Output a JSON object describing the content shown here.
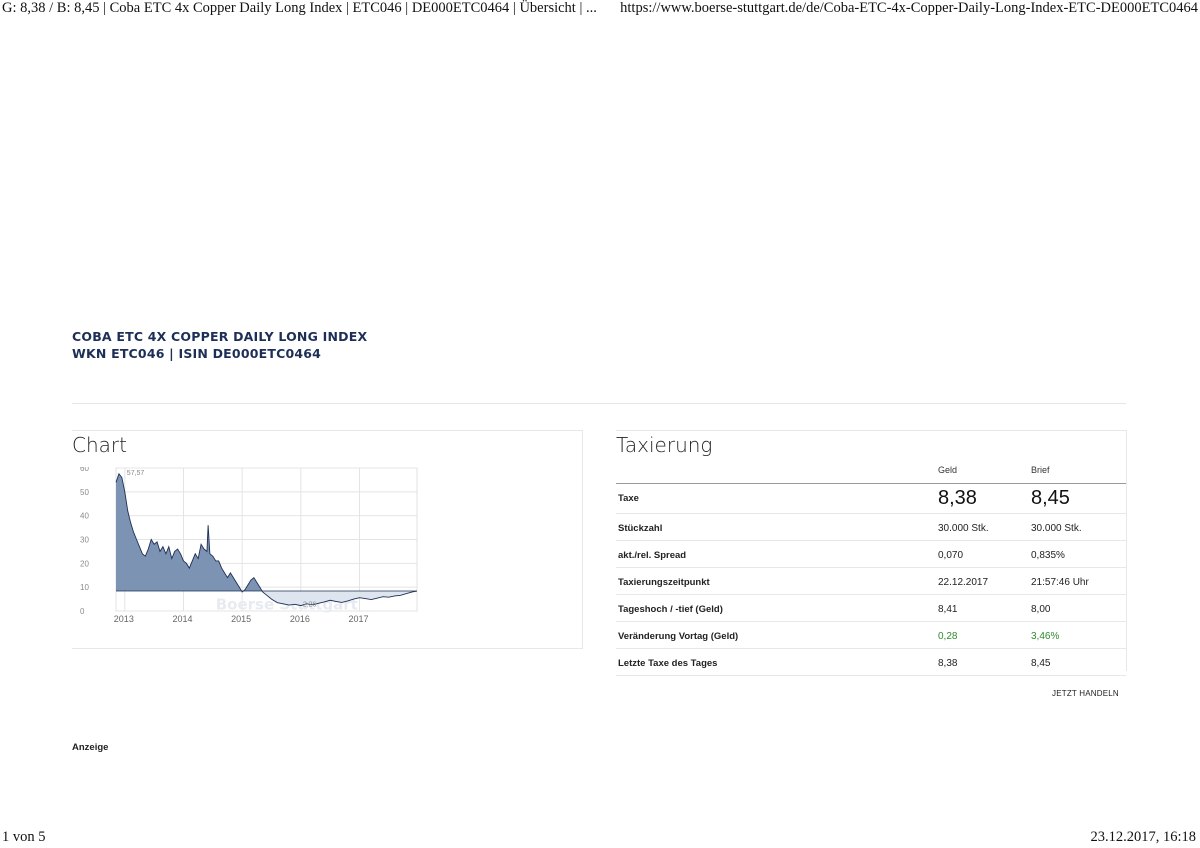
{
  "print_header": {
    "title": "G: 8,38 / B: 8,45 | Coba ETC 4x Copper Daily Long Index | ETC046 | DE000ETC0464 | Übersicht | ...",
    "url": "https://www.boerse-stuttgart.de/de/Coba-ETC-4x-Copper-Daily-Long-Index-ETC-DE000ETC0464"
  },
  "print_footer": {
    "page": "1 von 5",
    "datetime": "23.12.2017, 16:18"
  },
  "product": {
    "name": "COBA ETC 4X COPPER DAILY LONG INDEX",
    "ids": "WKN ETC046 | ISIN DE000ETC0464"
  },
  "chart_section": {
    "heading": "Chart",
    "watermark": "Boerse Stuttgart"
  },
  "chart_data": {
    "type": "area",
    "title": "",
    "xlabel": "",
    "ylabel": "",
    "x_ticks": [
      "2013",
      "2014",
      "2015",
      "2016",
      "2017"
    ],
    "y_ticks": [
      "0",
      "10",
      "20",
      "30",
      "40",
      "50",
      "60"
    ],
    "ylim": [
      0,
      60
    ],
    "xlim": [
      2012.85,
      2017.98
    ],
    "reference_line": 8.38,
    "annotations": [
      {
        "label": "57,57",
        "x": 2013.0,
        "y": 57.57
      },
      {
        "label": "2,26",
        "x": 2016.0,
        "y": 2.26
      }
    ],
    "colors": {
      "area_above": "#7d93b3",
      "area_below": "#dfe5ee",
      "line": "#1d2f56"
    },
    "series": [
      {
        "x": [
          2012.85,
          2012.9,
          2012.95,
          2013.0,
          2013.05,
          2013.1,
          2013.15,
          2013.2,
          2013.25,
          2013.3,
          2013.35,
          2013.4,
          2013.45,
          2013.5,
          2013.55,
          2013.6,
          2013.65,
          2013.7,
          2013.75,
          2013.8,
          2013.85,
          2013.9,
          2013.95,
          2014.0,
          2014.05,
          2014.1,
          2014.15,
          2014.2,
          2014.25,
          2014.3,
          2014.35,
          2014.4,
          2014.42,
          2014.45,
          2014.5,
          2014.55,
          2014.6,
          2014.65,
          2014.7,
          2014.75,
          2014.8,
          2014.85,
          2014.9,
          2014.95,
          2015.0,
          2015.05,
          2015.1,
          2015.15,
          2015.2,
          2015.25,
          2015.3,
          2015.35,
          2015.4,
          2015.5,
          2015.6,
          2015.7,
          2015.8,
          2015.9,
          2016.0,
          2016.1,
          2016.2,
          2016.3,
          2016.4,
          2016.5,
          2016.6,
          2016.7,
          2016.8,
          2016.9,
          2017.0,
          2017.1,
          2017.2,
          2017.3,
          2017.4,
          2017.5,
          2017.6,
          2017.7,
          2017.8,
          2017.9,
          2017.98
        ],
        "y": [
          54,
          57.57,
          56,
          50,
          42,
          37,
          33,
          30,
          27,
          24,
          23,
          26,
          30,
          28,
          29,
          25,
          27,
          24,
          27,
          22,
          25,
          26,
          24,
          21,
          20,
          18,
          21,
          24,
          22,
          28,
          26,
          25,
          36,
          24,
          23,
          21,
          21,
          18,
          16,
          14,
          16,
          14,
          12,
          10,
          8,
          9,
          11,
          13,
          14,
          12,
          10,
          8,
          7,
          5,
          3.5,
          3,
          2.5,
          2.8,
          2.26,
          3,
          2.6,
          3.2,
          3.8,
          4.5,
          4,
          3.6,
          4.2,
          5,
          5.6,
          5.2,
          4.8,
          5.4,
          6,
          5.8,
          6.3,
          6.6,
          7.3,
          8,
          8.38
        ]
      }
    ]
  },
  "tax_section": {
    "heading": "Taxierung",
    "col_geld": "Geld",
    "col_brief": "Brief",
    "rows": [
      {
        "label": "Taxe",
        "geld": "8,38",
        "brief": "8,45"
      },
      {
        "label": "Stückzahl",
        "geld": "30.000 Stk.",
        "brief": "30.000 Stk."
      },
      {
        "label": "akt./rel. Spread",
        "geld": "0,070",
        "brief": "0,835%"
      },
      {
        "label": "Taxierungszeitpunkt",
        "geld": "22.12.2017",
        "brief": "21:57:46 Uhr"
      },
      {
        "label": "Tageshoch / -tief (Geld)",
        "geld": "8,41",
        "brief": "8,00"
      },
      {
        "label": "Veränderung Vortag (Geld)",
        "geld": "0,28",
        "brief": "3,46%"
      },
      {
        "label": "Letzte Taxe des Tages",
        "geld": "8,38",
        "brief": "8,45"
      }
    ],
    "trade_link": "JETZT HANDELN",
    "positive_color": "#2f8a2f"
  },
  "ad": {
    "label": "Anzeige"
  }
}
